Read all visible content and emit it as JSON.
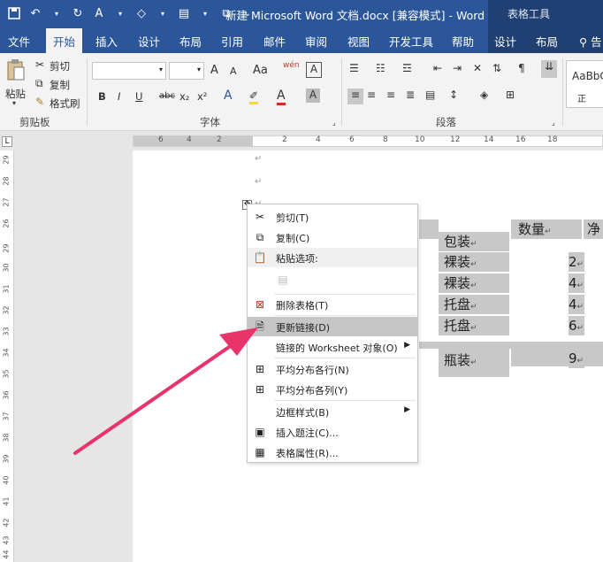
{
  "window": {
    "title": "新建 Microsoft Word 文档.docx [兼容模式]  -  Word",
    "contextual_tab_group": "表格工具"
  },
  "qat": {
    "save_icon": "save-icon",
    "undo_icon": "undo-icon",
    "redo_icon": "redo-icon"
  },
  "tabs": [
    {
      "label": "文件"
    },
    {
      "label": "开始"
    },
    {
      "label": "插入"
    },
    {
      "label": "设计"
    },
    {
      "label": "布局"
    },
    {
      "label": "引用"
    },
    {
      "label": "邮件"
    },
    {
      "label": "审阅"
    },
    {
      "label": "视图"
    },
    {
      "label": "开发工具"
    },
    {
      "label": "帮助"
    },
    {
      "label": "设计"
    },
    {
      "label": "布局"
    },
    {
      "label": "告"
    }
  ],
  "ribbon": {
    "clipboard": {
      "paste": "粘贴",
      "cut": "剪切",
      "copy": "复制",
      "format_painter": "格式刷",
      "label": "剪贴板"
    },
    "font": {
      "label": "字体",
      "grow": "A",
      "shrink": "A",
      "case": "Aa",
      "phonetic": "wén",
      "border_char": "A",
      "bold": "B",
      "italic": "I",
      "underline": "U",
      "strike": "abc",
      "sub": "x₂",
      "sup": "x²"
    },
    "paragraph": {
      "label": "段落"
    },
    "styles": {
      "preview": "AaBbC",
      "name": "正"
    }
  },
  "ruler": {
    "h_numbers": [
      "6",
      "4",
      "2",
      "2",
      "4",
      "6",
      "8",
      "10",
      "12",
      "14",
      "16",
      "18"
    ],
    "v_numbers": [
      "29",
      "28",
      "27",
      "26",
      "29",
      "30",
      "31",
      "32",
      "33",
      "34",
      "35",
      "36",
      "37",
      "38",
      "39",
      "40",
      "41",
      "42",
      "43",
      "44"
    ]
  },
  "document": {
    "paragraph_mark": "↵",
    "table": {
      "headers": [
        "包装",
        "数量",
        "净"
      ],
      "rows": [
        [
          "裸装",
          "2"
        ],
        [
          "裸装",
          "4"
        ],
        [
          "托盘",
          "4"
        ],
        [
          "托盘",
          "6"
        ],
        [
          "瓶装",
          "9"
        ]
      ]
    }
  },
  "context_menu": {
    "items": [
      {
        "label": "剪切(T)",
        "icon": "scissors-icon"
      },
      {
        "label": "复制(C)",
        "icon": "copy-icon"
      },
      {
        "label": "粘贴选项:",
        "icon": "paste-icon"
      },
      {
        "label": "",
        "icon": "paste-keep-icon"
      },
      {
        "label": "删除表格(T)",
        "icon": "delete-table-icon"
      },
      {
        "label": "更新链接(D)",
        "icon": "update-link-icon"
      },
      {
        "label": "链接的 Worksheet 对象(O)",
        "icon": ""
      },
      {
        "label": "平均分布各行(N)",
        "icon": "distribute-rows-icon"
      },
      {
        "label": "平均分布各列(Y)",
        "icon": "distribute-cols-icon"
      },
      {
        "label": "边框样式(B)",
        "icon": ""
      },
      {
        "label": "插入题注(C)...",
        "icon": "caption-icon"
      },
      {
        "label": "表格属性(R)...",
        "icon": "table-props-icon"
      }
    ]
  },
  "colors": {
    "word_blue": "#2b579a",
    "table_tools": "#203f73",
    "annotation_arrow": "#e8336b"
  }
}
